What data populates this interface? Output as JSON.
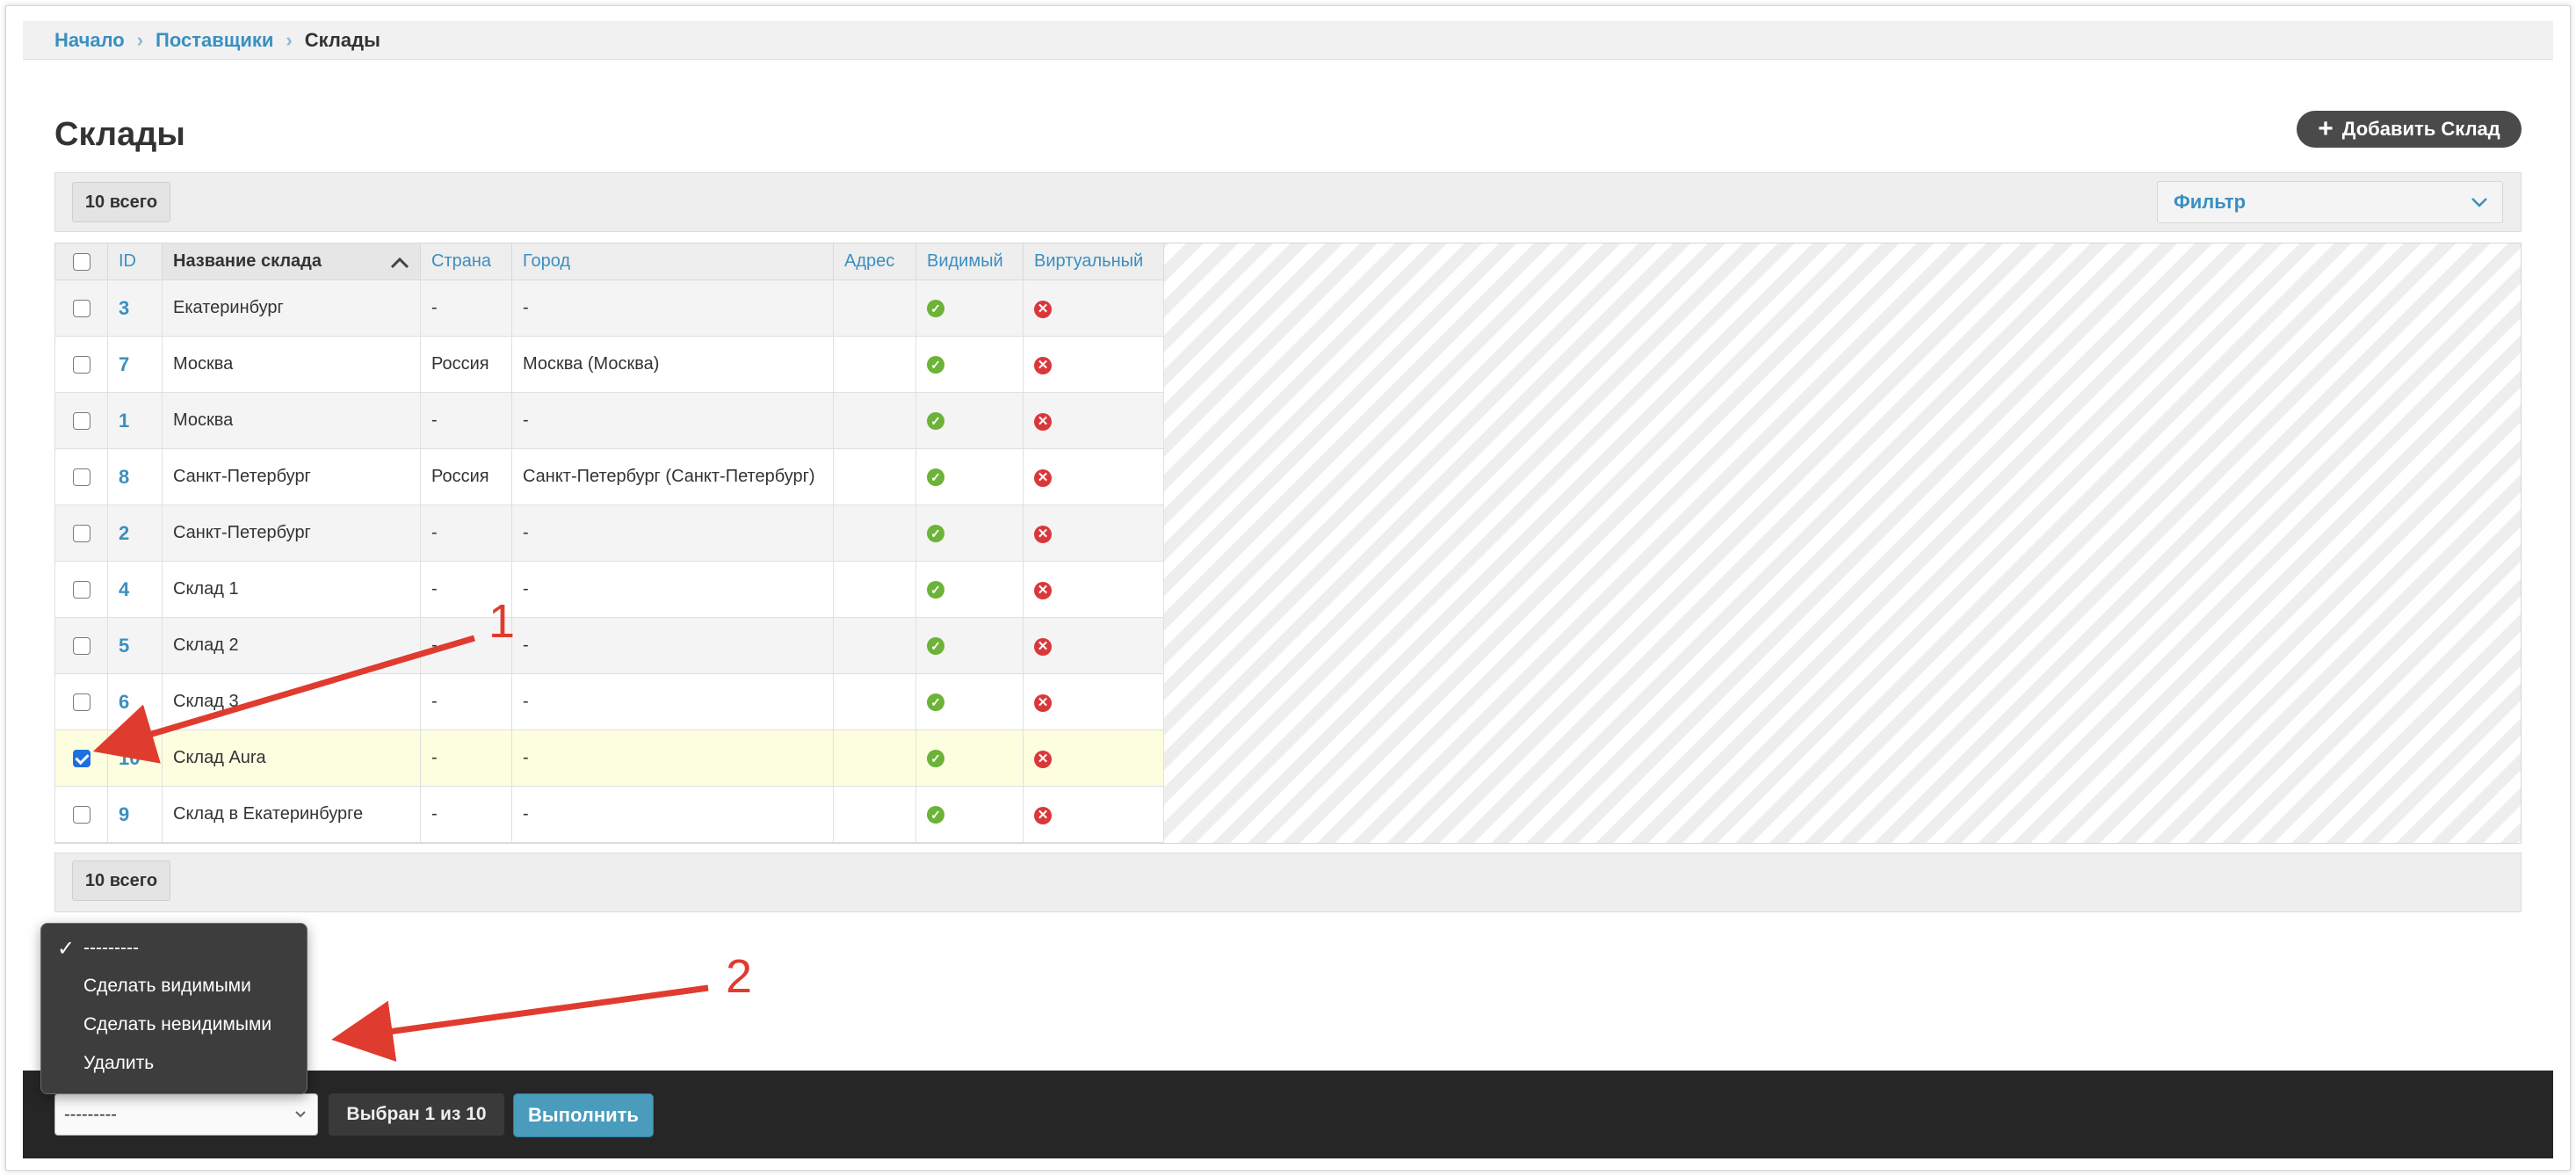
{
  "breadcrumb": {
    "home": "Начало",
    "suppliers": "Поставщики",
    "current": "Склады"
  },
  "page": {
    "title": "Склады",
    "add_button": "Добавить Склад"
  },
  "toolbar": {
    "total": "10 всего",
    "filter_label": "Фильтр"
  },
  "table": {
    "columns": {
      "id": "ID",
      "name": "Название склада",
      "country": "Страна",
      "city": "Город",
      "address": "Адрес",
      "visible": "Видимый",
      "virtual": "Виртуальный"
    },
    "rows": [
      {
        "id": "3",
        "name": "Екатеринбург",
        "country": "-",
        "city": "-",
        "address": "",
        "visible": true,
        "virtual": false,
        "checked": false
      },
      {
        "id": "7",
        "name": "Москва",
        "country": "Россия",
        "city": "Москва (Москва)",
        "address": "",
        "visible": true,
        "virtual": false,
        "checked": false
      },
      {
        "id": "1",
        "name": "Москва",
        "country": "-",
        "city": "-",
        "address": "",
        "visible": true,
        "virtual": false,
        "checked": false
      },
      {
        "id": "8",
        "name": "Санкт-Петербург",
        "country": "Россия",
        "city": "Санкт-Петербург (Санкт-Петербург)",
        "address": "",
        "visible": true,
        "virtual": false,
        "checked": false
      },
      {
        "id": "2",
        "name": "Санкт-Петербург",
        "country": "-",
        "city": "-",
        "address": "",
        "visible": true,
        "virtual": false,
        "checked": false
      },
      {
        "id": "4",
        "name": "Склад 1",
        "country": "-",
        "city": "-",
        "address": "",
        "visible": true,
        "virtual": false,
        "checked": false
      },
      {
        "id": "5",
        "name": "Склад 2",
        "country": "-",
        "city": "-",
        "address": "",
        "visible": true,
        "virtual": false,
        "checked": false
      },
      {
        "id": "6",
        "name": "Склад 3",
        "country": "-",
        "city": "-",
        "address": "",
        "visible": true,
        "virtual": false,
        "checked": false
      },
      {
        "id": "10",
        "name": "Склад Aura",
        "country": "-",
        "city": "-",
        "address": "",
        "visible": true,
        "virtual": false,
        "checked": true
      },
      {
        "id": "9",
        "name": "Склад в Екатеринбурге",
        "country": "-",
        "city": "-",
        "address": "",
        "visible": true,
        "virtual": false,
        "checked": false
      }
    ]
  },
  "footer": {
    "total": "10 всего"
  },
  "annotations": {
    "one": "1",
    "two": "2"
  },
  "actions": {
    "menu": {
      "selected": "---------",
      "items": [
        "Сделать видимыми",
        "Сделать невидимыми",
        "Удалить"
      ]
    },
    "select_value": "---------",
    "selected_count": "Выбран 1 из 10",
    "run_button": "Выполнить"
  },
  "colors": {
    "link": "#3a8fc1",
    "ok": "#6cb338",
    "no": "#d9383a",
    "annotation": "#e03b2f",
    "run_button": "#4a9cbd"
  }
}
